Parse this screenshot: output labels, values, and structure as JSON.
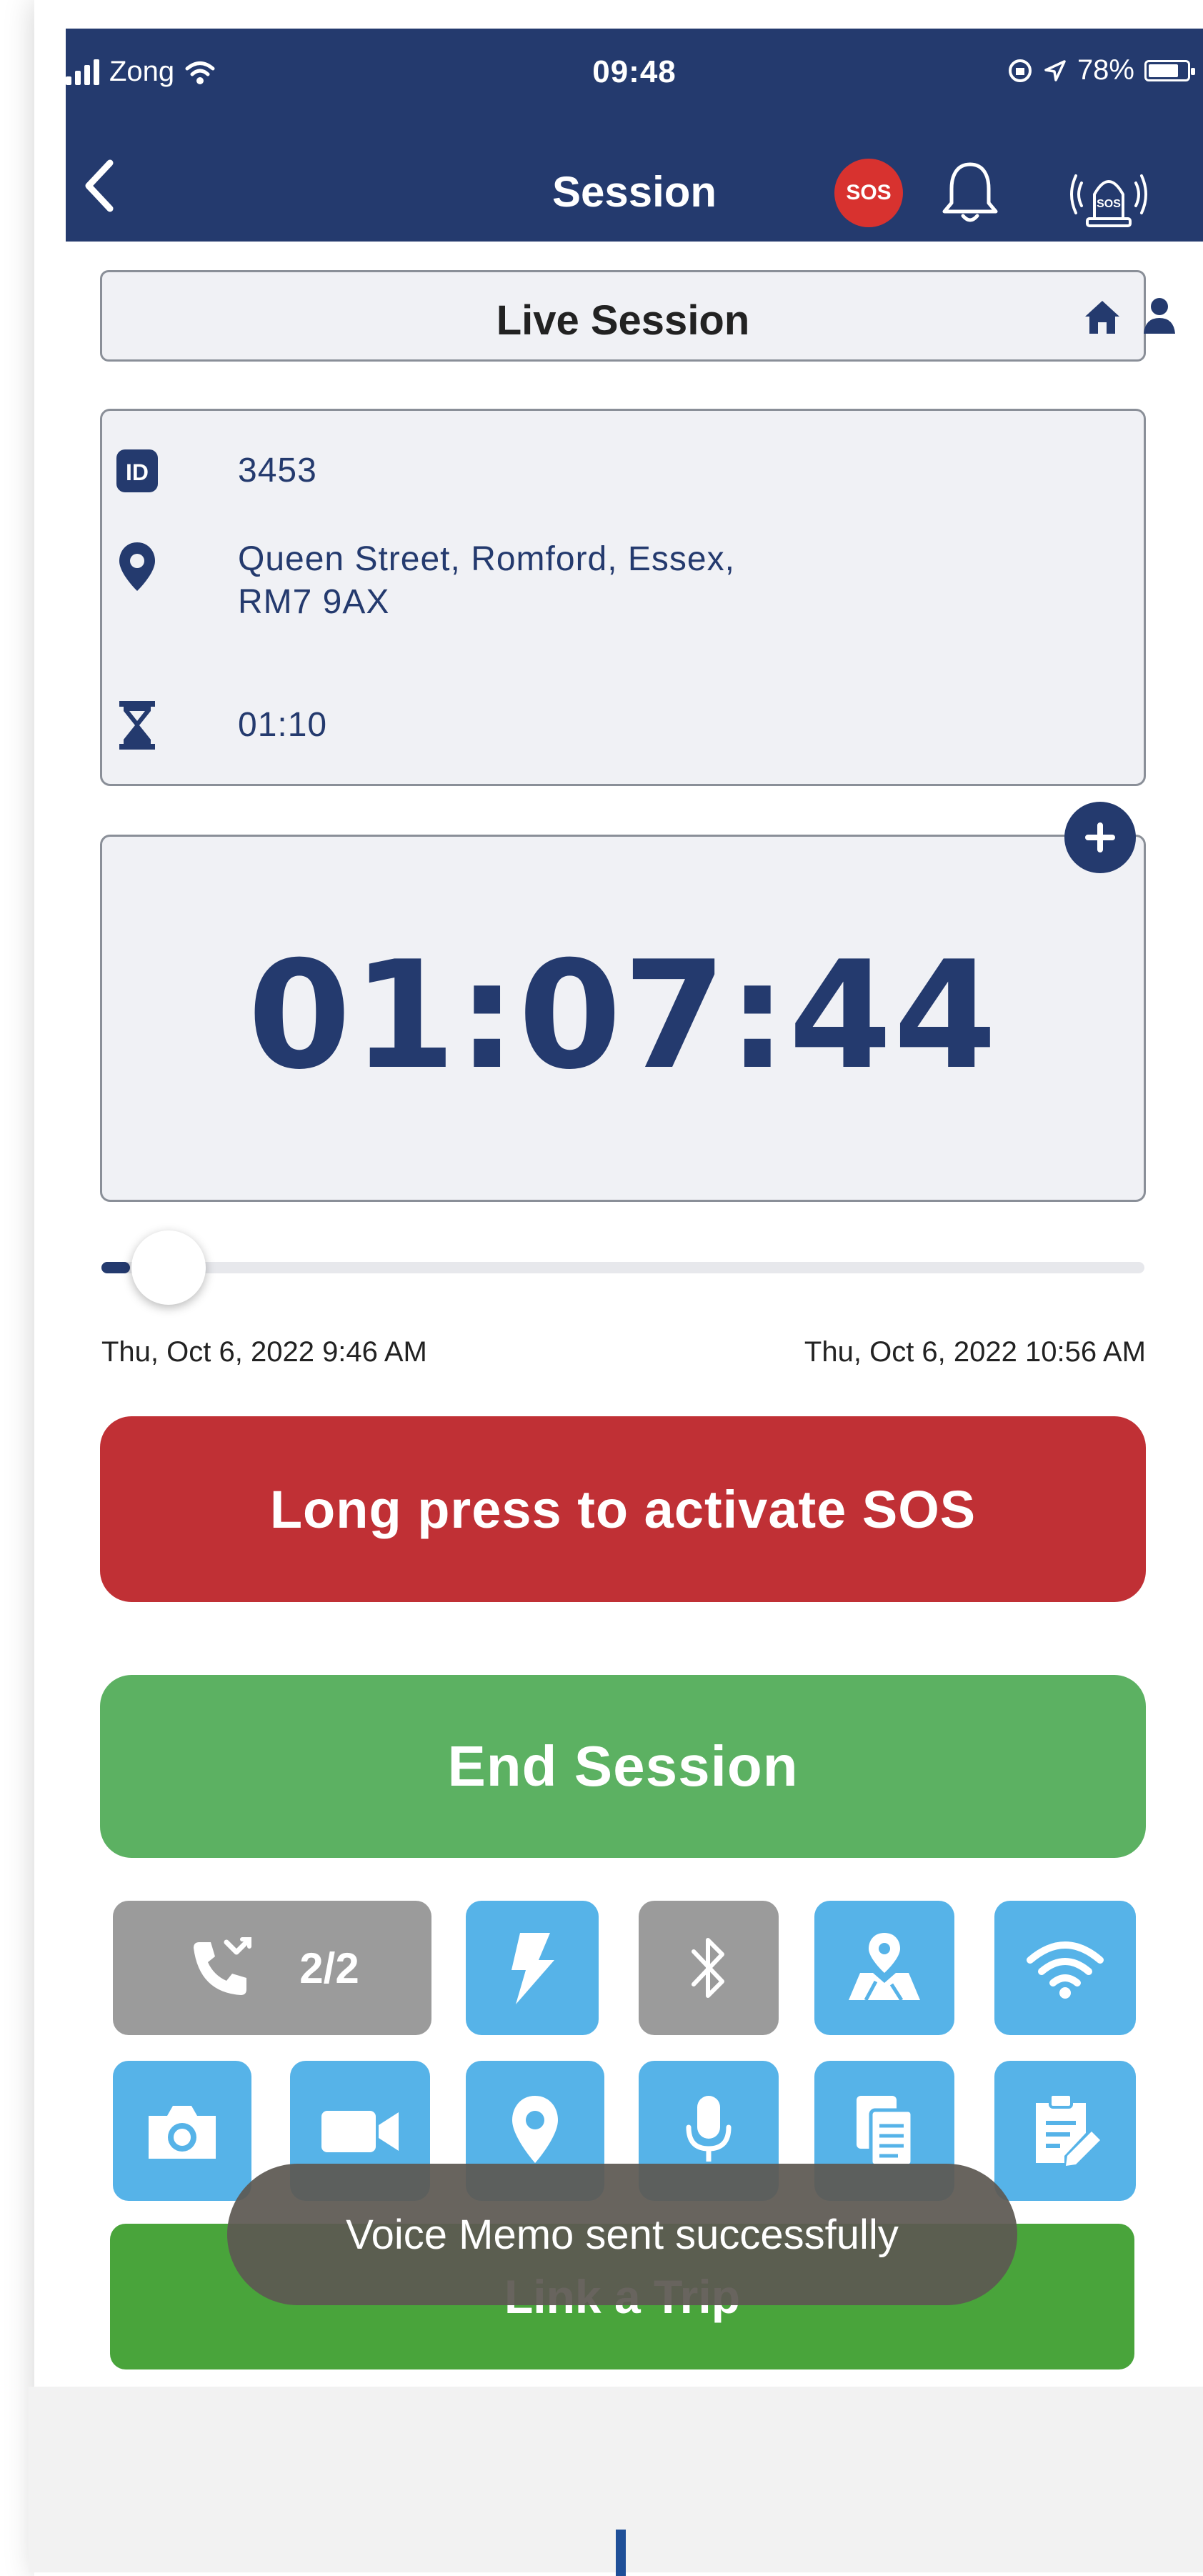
{
  "status_bar": {
    "carrier": "Zong",
    "time": "09:48",
    "battery": "78%",
    "battery_level": 0.78
  },
  "nav": {
    "title": "Session",
    "sos_badge": "SOS",
    "icons": [
      "chevron-left-icon",
      "bell-icon",
      "sos-alarm-icon"
    ]
  },
  "live_bar": {
    "title": "Live Session",
    "icons": [
      "home-icon",
      "user-icon"
    ]
  },
  "info": {
    "id": "3453",
    "address_line1": "Queen Street, Romford, Essex,",
    "address_line2": "RM7 9AX",
    "duration": "01:10"
  },
  "timer": {
    "value": "01:07:44"
  },
  "progress": {
    "fraction": 0.02,
    "start": "Thu, Oct 6, 2022 9:46 AM",
    "end": "Thu, Oct 6, 2022 10:56 AM"
  },
  "buttons": {
    "sos": "Long press to activate SOS",
    "end_session": "End Session",
    "link_trip": "Link a Trip"
  },
  "calls": {
    "count": "2/2"
  },
  "tiles_row1": [
    "missed-call-icon",
    "flash-icon",
    "bluetooth-icon",
    "map-icon",
    "wifi-icon"
  ],
  "tiles_row2": [
    "camera-icon",
    "video-icon",
    "location-pin-icon",
    "microphone-icon",
    "documents-icon",
    "clipboard-edit-icon"
  ],
  "toast": "Voice Memo sent successfully",
  "colors": {
    "header": "#243a6e",
    "sos_red": "#c03035",
    "end_green": "#5cb162",
    "link_green": "#49a43b",
    "tile_blue": "#56b3e8",
    "tile_gray": "#9b9b9b"
  }
}
